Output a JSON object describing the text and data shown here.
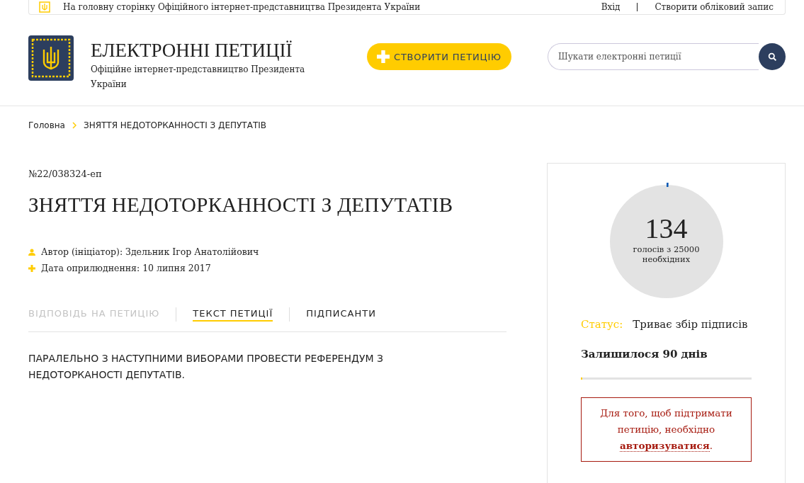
{
  "top_bar": {
    "home_link": "На головну сторінку Офіційного інтернет-представництва Президента України",
    "login": "Вхід",
    "register": "Створити обліковий запис"
  },
  "header": {
    "title": "ЕЛЕКТРОННІ ПЕТИЦІЇ",
    "subtitle": "Офіційне інтернет-представництво Президента України",
    "create_button": "СТВОРИТИ ПЕТИЦІЮ",
    "search": {
      "placeholder": "Шукати електронні петиції"
    }
  },
  "breadcrumb": [
    "Головна",
    "ЗНЯТТЯ НЕДОТОРКАННОСТІ З ДЕПУТАТІВ"
  ],
  "petition": {
    "number": "№22/038324-еп",
    "title": "ЗНЯТТЯ НЕДОТОРКАННОСТІ З ДЕПУТАТІВ",
    "author": "Автор (ініціатор): Здельник Ігор Анатолійович",
    "date": "Дата оприлюднення: 10 липня 2017",
    "tabs": [
      {
        "label": "ВІДПОВІДЬ НА ПЕТИЦІЮ",
        "selected": false,
        "disabled": true
      },
      {
        "label": "ТЕКСТ ПЕТИЦІЇ",
        "selected": true,
        "disabled": false
      },
      {
        "label": "ПІДПИСАНТИ",
        "selected": false,
        "disabled": false
      }
    ],
    "text": "ПАРАЛЕЛЬНО З НАСТУПНИМИ ВИБОРАМИ ПРОВЕСТИ РЕФЕРЕНДУМ З НЕДОТОРКАНОСТІ ДЕПУТАТІВ."
  },
  "sidebar": {
    "votes": {
      "count": "134",
      "caption": "голосів з 25000 необхідних",
      "level": 0.00536
    },
    "status_label": "Статус:",
    "status": "Триває збір підписів",
    "days_left": {
      "text": "Залишилося 90 днів",
      "level": 0.01
    },
    "notice": {
      "text": "Для того, щоб підтримати петицію, необхідно ",
      "link": "авторизуватися",
      "end": "."
    }
  }
}
